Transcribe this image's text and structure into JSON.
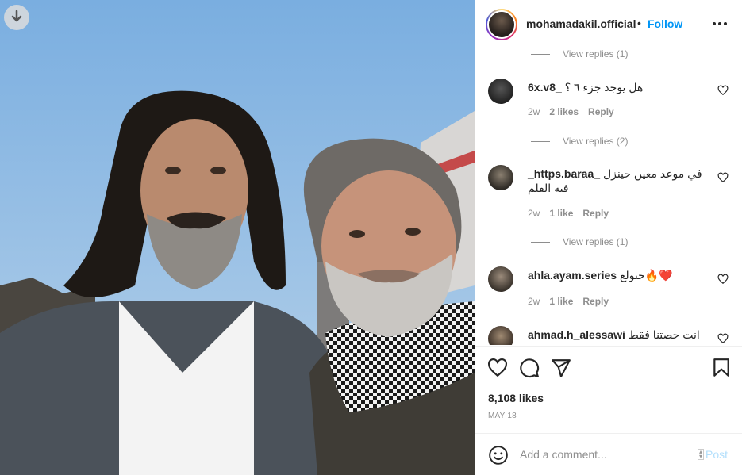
{
  "photo": {
    "download_label": "Download",
    "sky_top": "#7aaee0",
    "sky_bottom": "#b9d3ea"
  },
  "header": {
    "username": "mohamadakil.official",
    "separator": "•",
    "follow_label": "Follow",
    "more_icon": "more-horizontal-icon"
  },
  "comments": {
    "view_replies": [
      "View replies (1)",
      "View replies (2)",
      "View replies (1)"
    ],
    "items": [
      {
        "username": "6x.v8_",
        "text": "هل يوجد جزء ٦ ؟",
        "time": "2w",
        "likes": "2 likes",
        "reply": "Reply"
      },
      {
        "username": "_https.baraa_",
        "text": "في موعد معين حينزل فيه الفلم",
        "time": "2w",
        "likes": "1 like",
        "reply": "Reply"
      },
      {
        "username": "ahla.ayam.series",
        "text": "حتولع🔥❤️",
        "time": "2w",
        "likes": "1 like",
        "reply": "Reply"
      },
      {
        "username": "ahmad.h_alessawi",
        "text": "انت حصتنا فقط",
        "time": "",
        "likes": "",
        "reply": ""
      }
    ]
  },
  "actions": {
    "like_icon": "heart-icon",
    "comment_icon": "comment-icon",
    "share_icon": "share-icon",
    "save_icon": "bookmark-icon",
    "likes_count": "8,108 likes",
    "date": "MAY 18"
  },
  "add_comment": {
    "emoji_icon": "emoji-icon",
    "placeholder": "Add a comment...",
    "post_label": "Post"
  },
  "colors": {
    "accent": "#0095f6",
    "muted": "#8e8e8e",
    "post_disabled": "#b2dffc"
  }
}
